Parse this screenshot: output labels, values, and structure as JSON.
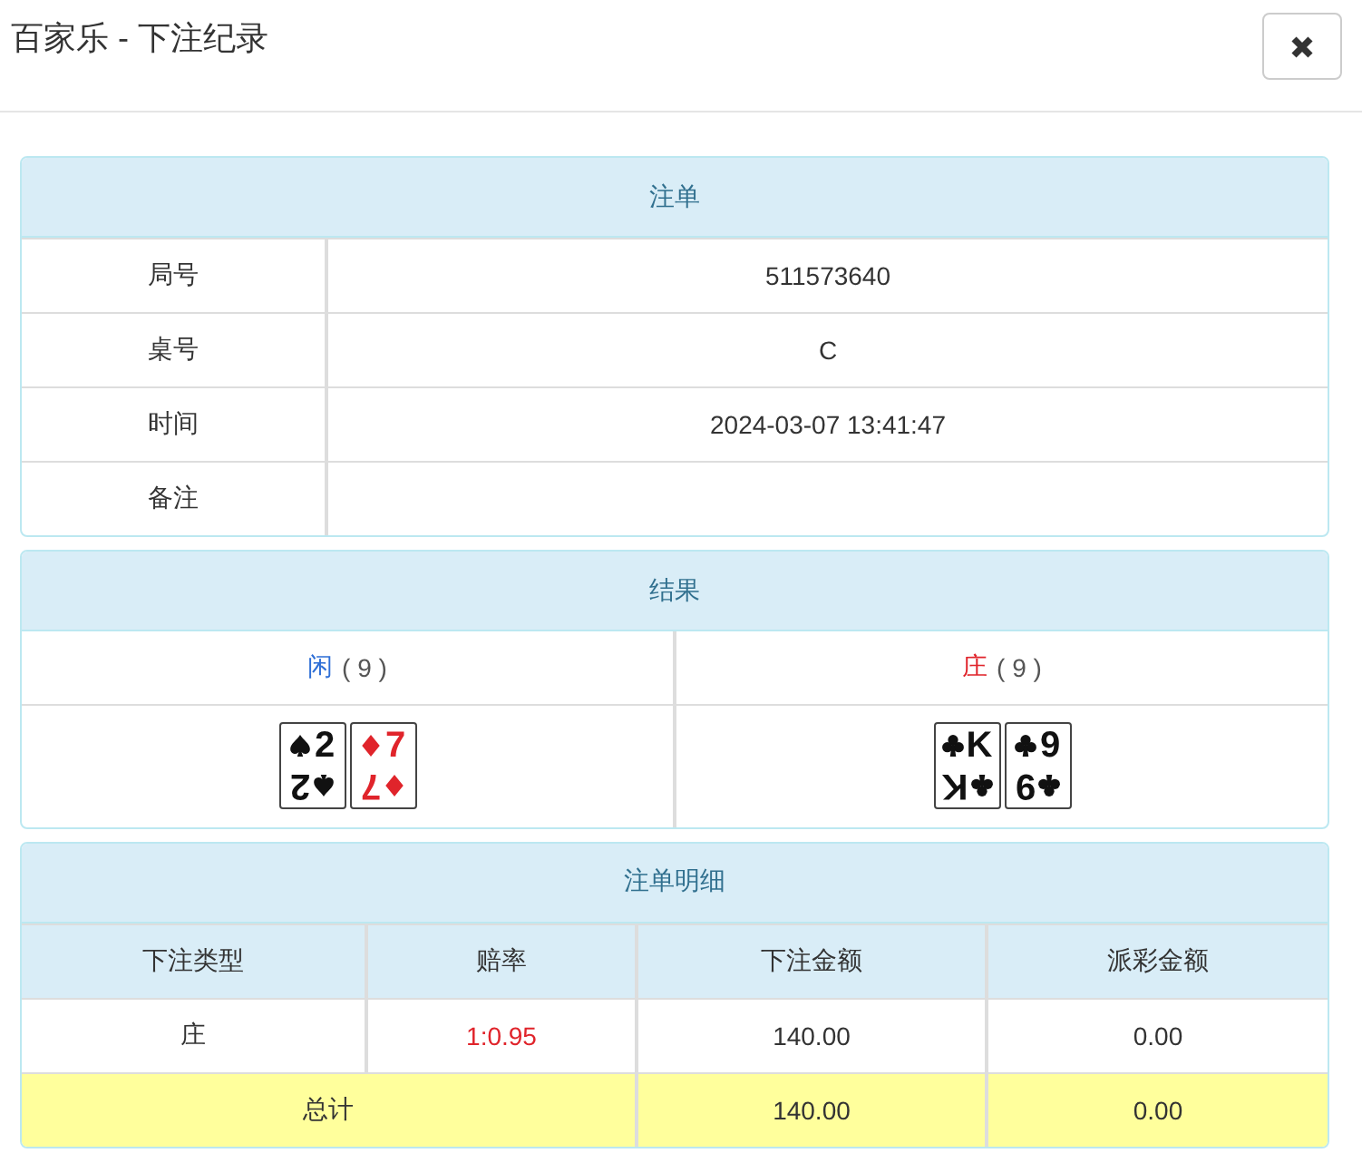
{
  "header": {
    "title": "百家乐 - 下注纪录"
  },
  "order": {
    "title": "注单",
    "rows": [
      {
        "label": "局号",
        "value": "511573640"
      },
      {
        "label": "桌号",
        "value": "C"
      },
      {
        "label": "时间",
        "value": "2024-03-07 13:41:47"
      },
      {
        "label": "备注"
      }
    ]
  },
  "result": {
    "title": "结果",
    "hands": [
      {
        "label": "闲",
        "color": "#2f6fd6",
        "score": "( 9 )",
        "cards": [
          {
            "kind": "spade",
            "rank": "2",
            "rank_rotated": "2"
          },
          {
            "kind": "diamond",
            "rank": "7",
            "rank_rotated": "7"
          }
        ]
      },
      {
        "label": "庄",
        "color": "#e0242b",
        "score": "( 9 )",
        "cards": [
          {
            "kind": "club",
            "rank": "K",
            "rank_rotated": "K"
          },
          {
            "kind": "club",
            "rank": "9",
            "rank_rotated": "9"
          }
        ]
      }
    ]
  },
  "details": {
    "title": "注单明细",
    "columns": [
      "下注类型",
      "赔率",
      "下注金额",
      "派彩金额"
    ],
    "rows": [
      {
        "kind": "bet",
        "cells": [
          {
            "text": "庄"
          },
          {
            "text": "1:0.95"
          },
          {
            "text": "140.00"
          },
          {
            "text": "0.00"
          }
        ]
      },
      {
        "kind": "total",
        "cells": [
          {
            "text": "总计",
            "colspan": 2
          },
          {
            "text": "140.00"
          },
          {
            "text": "0.00"
          }
        ]
      }
    ]
  }
}
